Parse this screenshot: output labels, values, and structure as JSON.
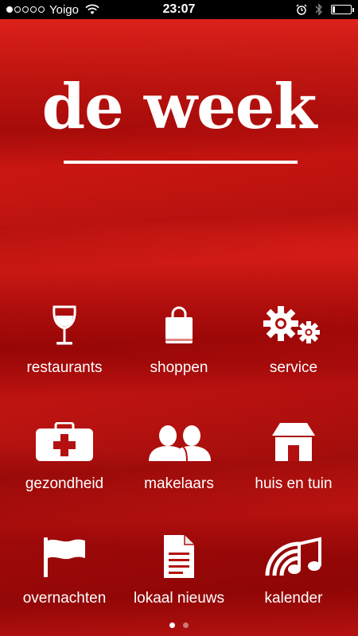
{
  "status_bar": {
    "carrier": "Yoigo",
    "time": "23:07",
    "signal_bars_filled": 1,
    "signal_bars_total": 5,
    "icons": [
      "wifi-icon",
      "alarm-icon",
      "bluetooth-icon",
      "battery-icon"
    ]
  },
  "header": {
    "title": "de week"
  },
  "menu": {
    "items": [
      {
        "label": "restaurants",
        "icon": "wine-glass-icon"
      },
      {
        "label": "shoppen",
        "icon": "shopping-bag-icon"
      },
      {
        "label": "service",
        "icon": "gears-icon"
      },
      {
        "label": "gezondheid",
        "icon": "medical-kit-icon"
      },
      {
        "label": "makelaars",
        "icon": "people-icon"
      },
      {
        "label": "huis en tuin",
        "icon": "house-icon"
      },
      {
        "label": "overnachten",
        "icon": "flag-icon"
      },
      {
        "label": "lokaal nieuws",
        "icon": "document-icon"
      },
      {
        "label": "kalender",
        "icon": "music-icon"
      }
    ]
  },
  "pager": {
    "total_pages": 2,
    "active_page": 1
  },
  "colors": {
    "background_red": "#c0120f",
    "text": "#ffffff"
  }
}
